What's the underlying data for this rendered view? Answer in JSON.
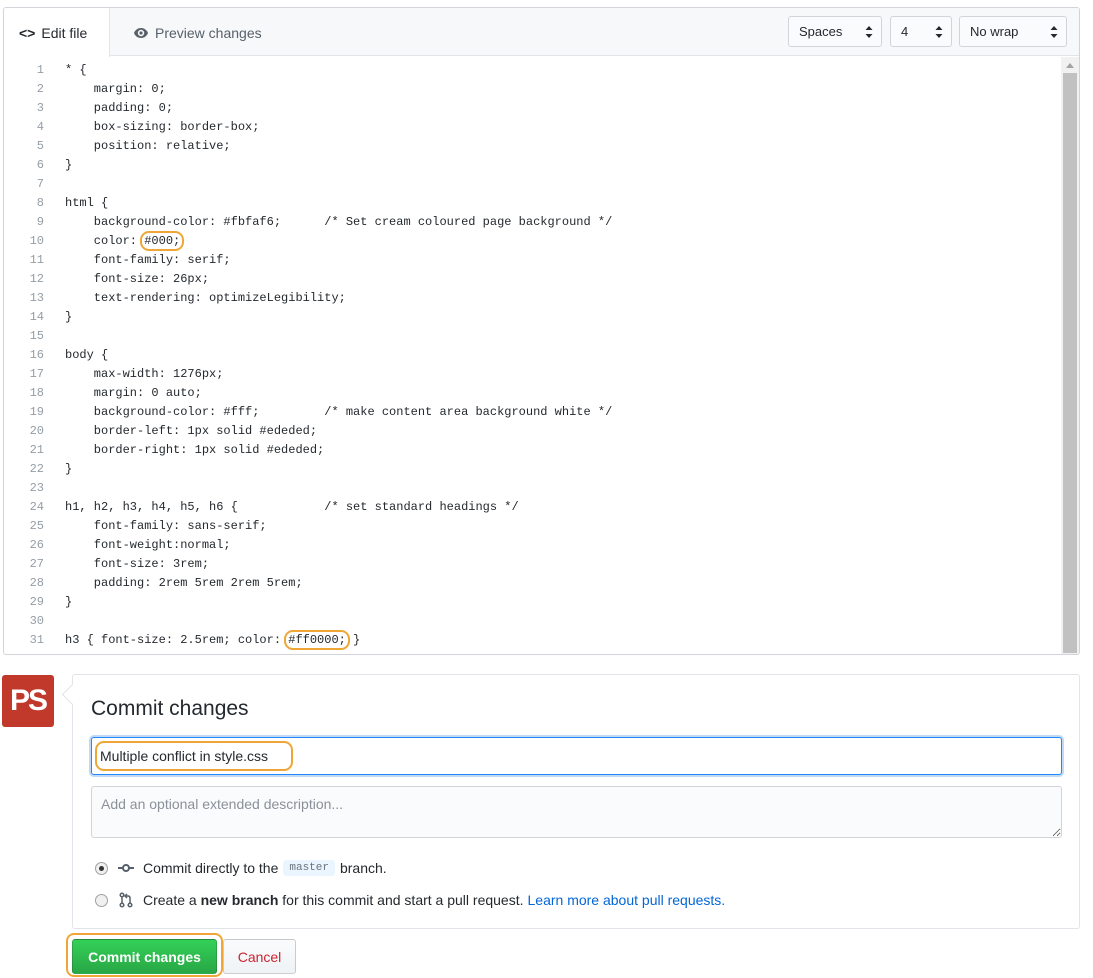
{
  "editor": {
    "tabs": {
      "edit_label": "Edit file",
      "preview_label": "Preview changes"
    },
    "indent_mode": {
      "value": "Spaces"
    },
    "indent_size": {
      "value": "4"
    },
    "wrap_mode": {
      "value": "No wrap"
    },
    "lines": [
      {
        "num": "1",
        "pre": "* {",
        "hl": "",
        "post": ""
      },
      {
        "num": "2",
        "pre": "    margin: 0;",
        "hl": "",
        "post": ""
      },
      {
        "num": "3",
        "pre": "    padding: 0;",
        "hl": "",
        "post": ""
      },
      {
        "num": "4",
        "pre": "    box-sizing: border-box;",
        "hl": "",
        "post": ""
      },
      {
        "num": "5",
        "pre": "    position: relative;",
        "hl": "",
        "post": ""
      },
      {
        "num": "6",
        "pre": "}",
        "hl": "",
        "post": ""
      },
      {
        "num": "7",
        "pre": "",
        "hl": "",
        "post": ""
      },
      {
        "num": "8",
        "pre": "html {",
        "hl": "",
        "post": ""
      },
      {
        "num": "9",
        "pre": "    background-color: #fbfaf6;      /* Set cream coloured page background */",
        "hl": "",
        "post": ""
      },
      {
        "num": "10",
        "pre": "    color: ",
        "hl": "#000;",
        "post": ""
      },
      {
        "num": "11",
        "pre": "    font-family: serif;",
        "hl": "",
        "post": ""
      },
      {
        "num": "12",
        "pre": "    font-size: 26px;",
        "hl": "",
        "post": ""
      },
      {
        "num": "13",
        "pre": "    text-rendering: optimizeLegibility;",
        "hl": "",
        "post": ""
      },
      {
        "num": "14",
        "pre": "}",
        "hl": "",
        "post": ""
      },
      {
        "num": "15",
        "pre": "",
        "hl": "",
        "post": ""
      },
      {
        "num": "16",
        "pre": "body {",
        "hl": "",
        "post": ""
      },
      {
        "num": "17",
        "pre": "    max-width: 1276px;",
        "hl": "",
        "post": ""
      },
      {
        "num": "18",
        "pre": "    margin: 0 auto;",
        "hl": "",
        "post": ""
      },
      {
        "num": "19",
        "pre": "    background-color: #fff;         /* make content area background white */",
        "hl": "",
        "post": ""
      },
      {
        "num": "20",
        "pre": "    border-left: 1px solid #ededed;",
        "hl": "",
        "post": ""
      },
      {
        "num": "21",
        "pre": "    border-right: 1px solid #ededed;",
        "hl": "",
        "post": ""
      },
      {
        "num": "22",
        "pre": "}",
        "hl": "",
        "post": ""
      },
      {
        "num": "23",
        "pre": "",
        "hl": "",
        "post": ""
      },
      {
        "num": "24",
        "pre": "h1, h2, h3, h4, h5, h6 {            /* set standard headings */",
        "hl": "",
        "post": ""
      },
      {
        "num": "25",
        "pre": "    font-family: sans-serif;",
        "hl": "",
        "post": ""
      },
      {
        "num": "26",
        "pre": "    font-weight:normal;",
        "hl": "",
        "post": ""
      },
      {
        "num": "27",
        "pre": "    font-size: 3rem;",
        "hl": "",
        "post": ""
      },
      {
        "num": "28",
        "pre": "    padding: 2rem 5rem 2rem 5rem;",
        "hl": "",
        "post": ""
      },
      {
        "num": "29",
        "pre": "}",
        "hl": "",
        "post": ""
      },
      {
        "num": "30",
        "pre": "",
        "hl": "",
        "post": ""
      },
      {
        "num": "31",
        "pre": "h3 { font-size: 2.5rem; color: ",
        "hl": "#ff0000;",
        "post": " }"
      }
    ]
  },
  "avatar": {
    "text": "PS"
  },
  "commit": {
    "title": "Commit changes",
    "summary_value": "Multiple conflict in style.css",
    "description_placeholder": "Add an optional extended description...",
    "option_direct": {
      "text_before": "Commit directly to the",
      "branch": "master",
      "text_after": "branch."
    },
    "option_new": {
      "text_before": "Create a ",
      "bold": "new branch",
      "text_after": " for this commit and start a pull request.",
      "link": "Learn more about pull requests."
    },
    "submit_label": "Commit changes",
    "cancel_label": "Cancel"
  },
  "colors": {
    "primary_button": "#28a745",
    "cancel_text": "#cb2431",
    "link": "#0366d6",
    "highlight_ring": "#f0a637"
  }
}
